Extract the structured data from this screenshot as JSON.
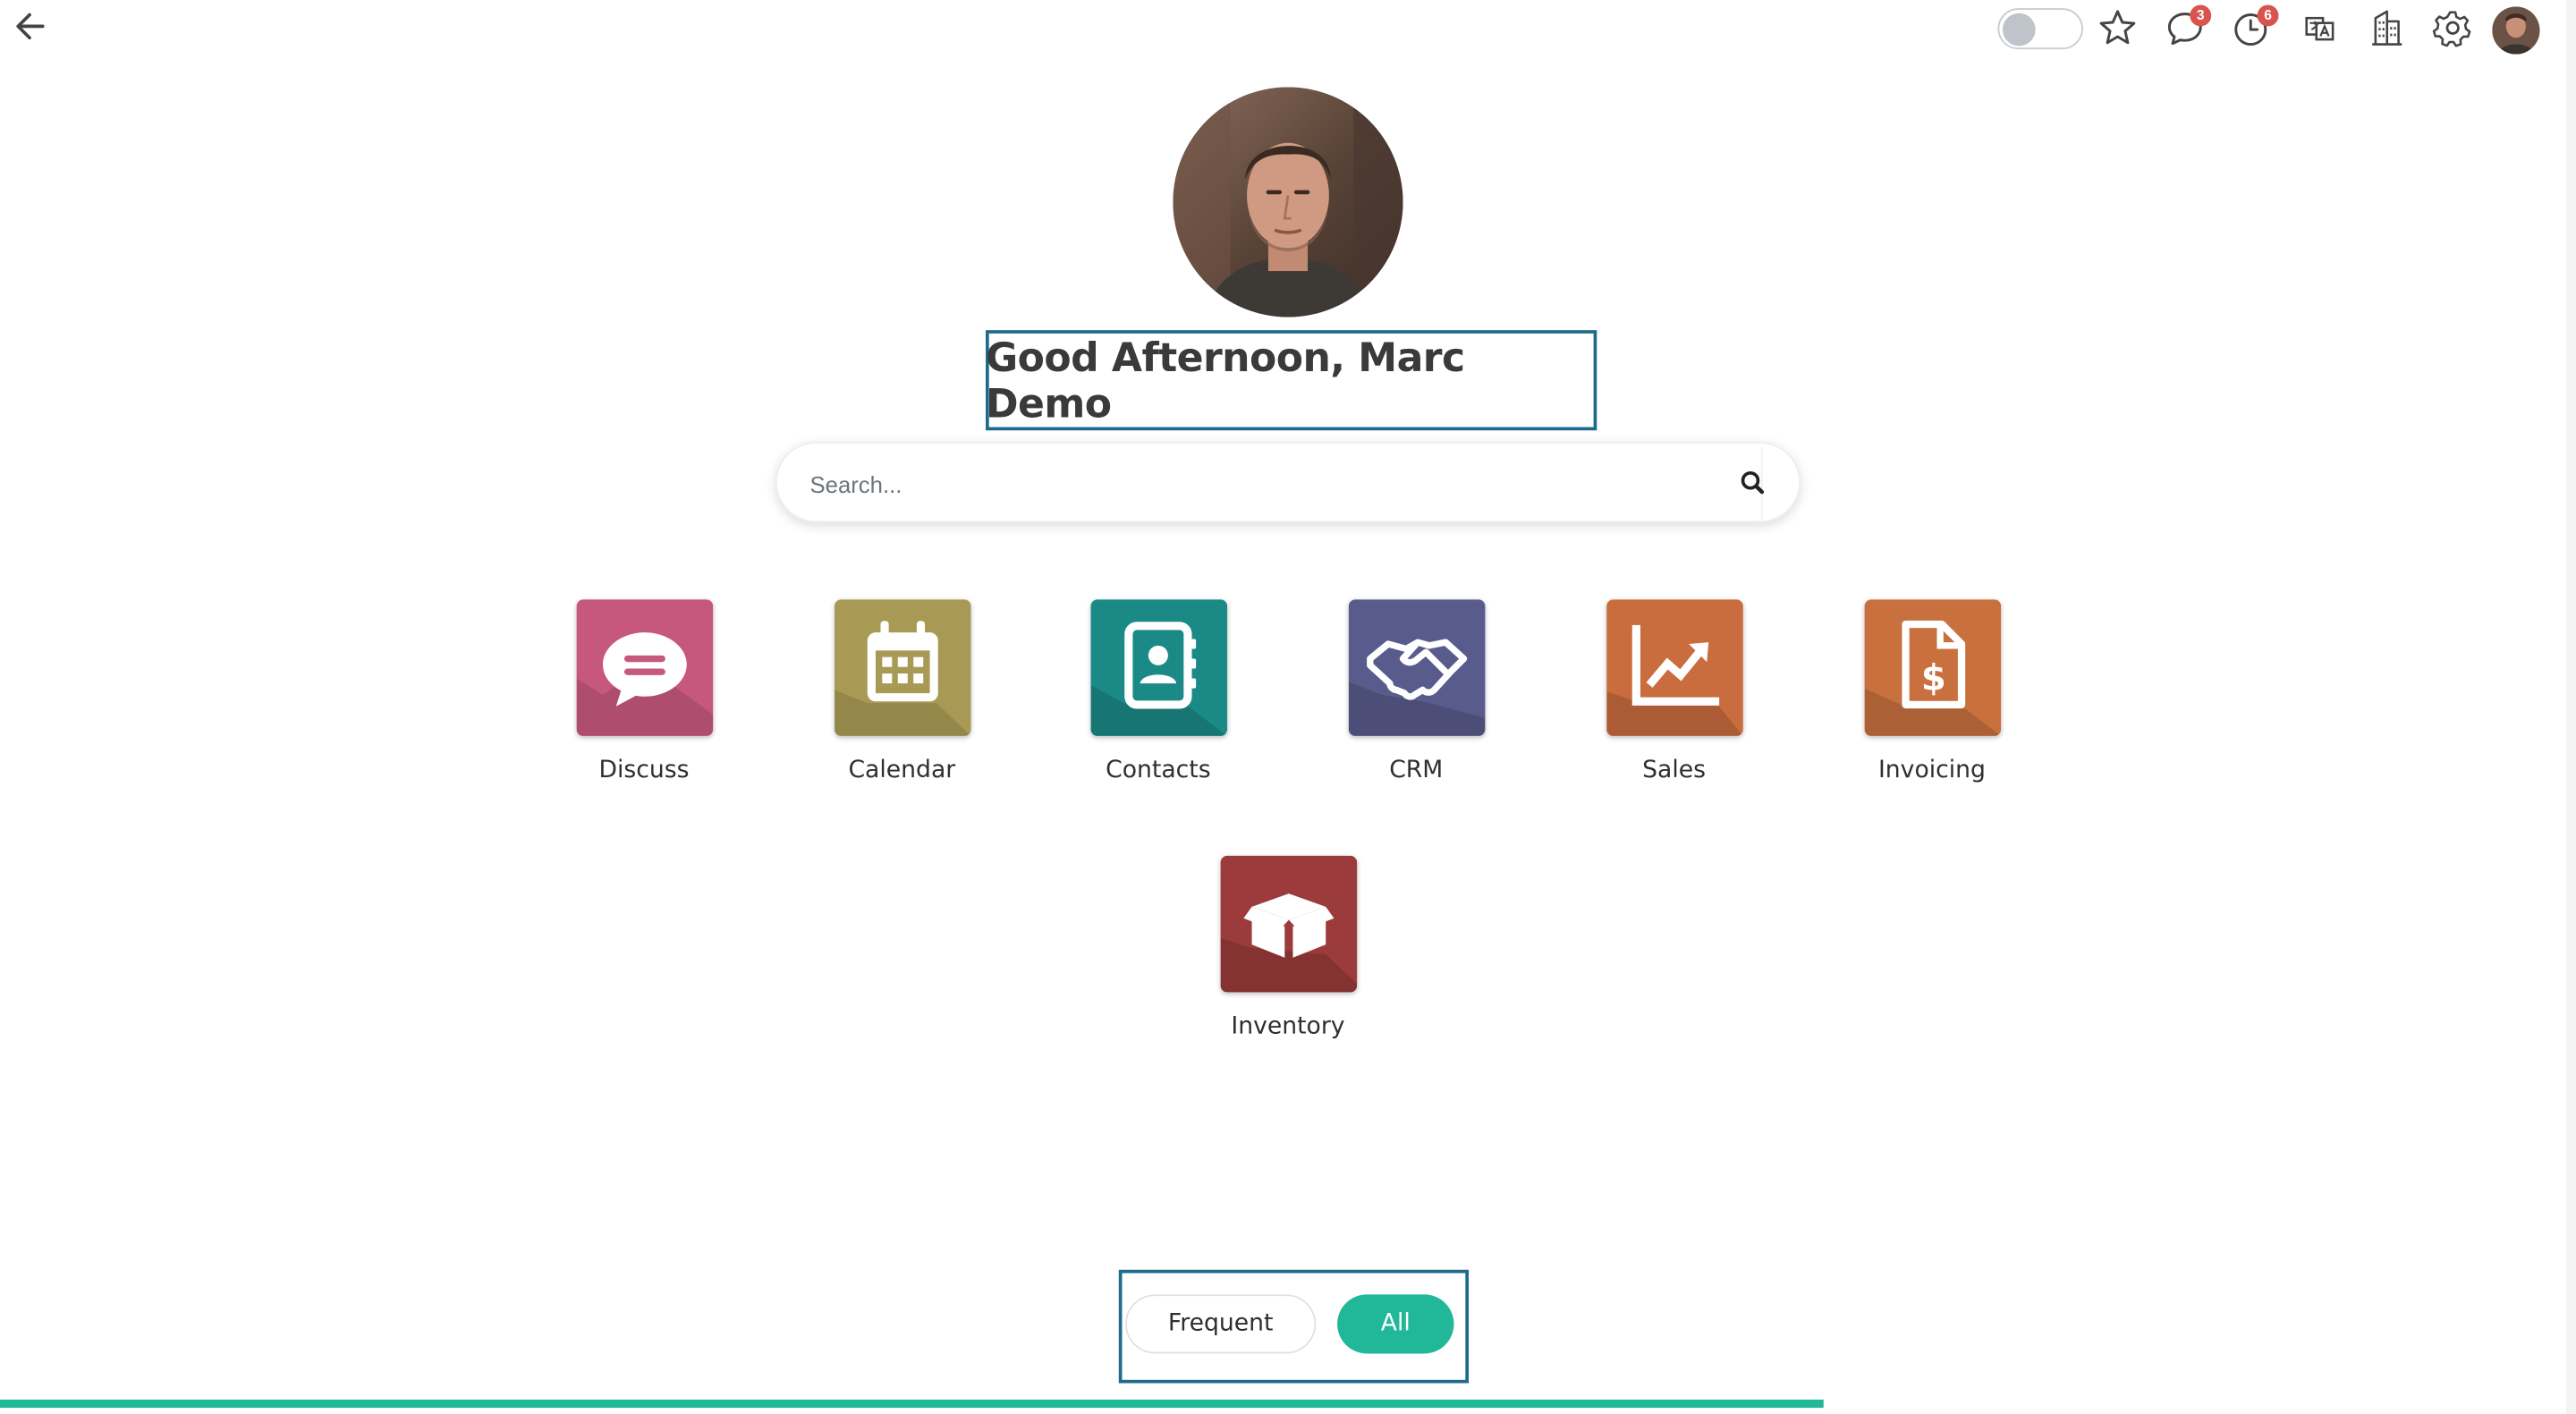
{
  "topbar": {
    "back_icon": "arrow-left-icon",
    "messages_badge": "3",
    "activities_badge": "6",
    "icons": [
      "toggle",
      "star-icon",
      "chat-bubble-icon",
      "clock-icon",
      "translate-icon",
      "building-icon",
      "gear-icon",
      "avatar"
    ]
  },
  "greeting": "Good Afternoon, Marc Demo",
  "search": {
    "placeholder": "Search..."
  },
  "apps": [
    {
      "label": "Discuss",
      "icon": "chat-bubble-icon",
      "color": "#c7587d"
    },
    {
      "label": "Calendar",
      "icon": "calendar-icon",
      "color": "#a89a55"
    },
    {
      "label": "Contacts",
      "icon": "address-book-icon",
      "color": "#1b8a86"
    },
    {
      "label": "CRM",
      "icon": "handshake-icon",
      "color": "#595b8c"
    },
    {
      "label": "Sales",
      "icon": "chart-line-icon",
      "color": "#c96c3e"
    },
    {
      "label": "Invoicing",
      "icon": "invoice-icon",
      "color": "#c9703f"
    },
    {
      "label": "Inventory",
      "icon": "box-icon",
      "color": "#9b3b3b"
    }
  ],
  "view_switch": {
    "frequent_label": "Frequent",
    "all_label": "All",
    "active": "All"
  },
  "progress": 0.708,
  "colors": {
    "accent": "#21b799",
    "highlight_border": "#1d6a8a",
    "badge": "#d9534f"
  }
}
